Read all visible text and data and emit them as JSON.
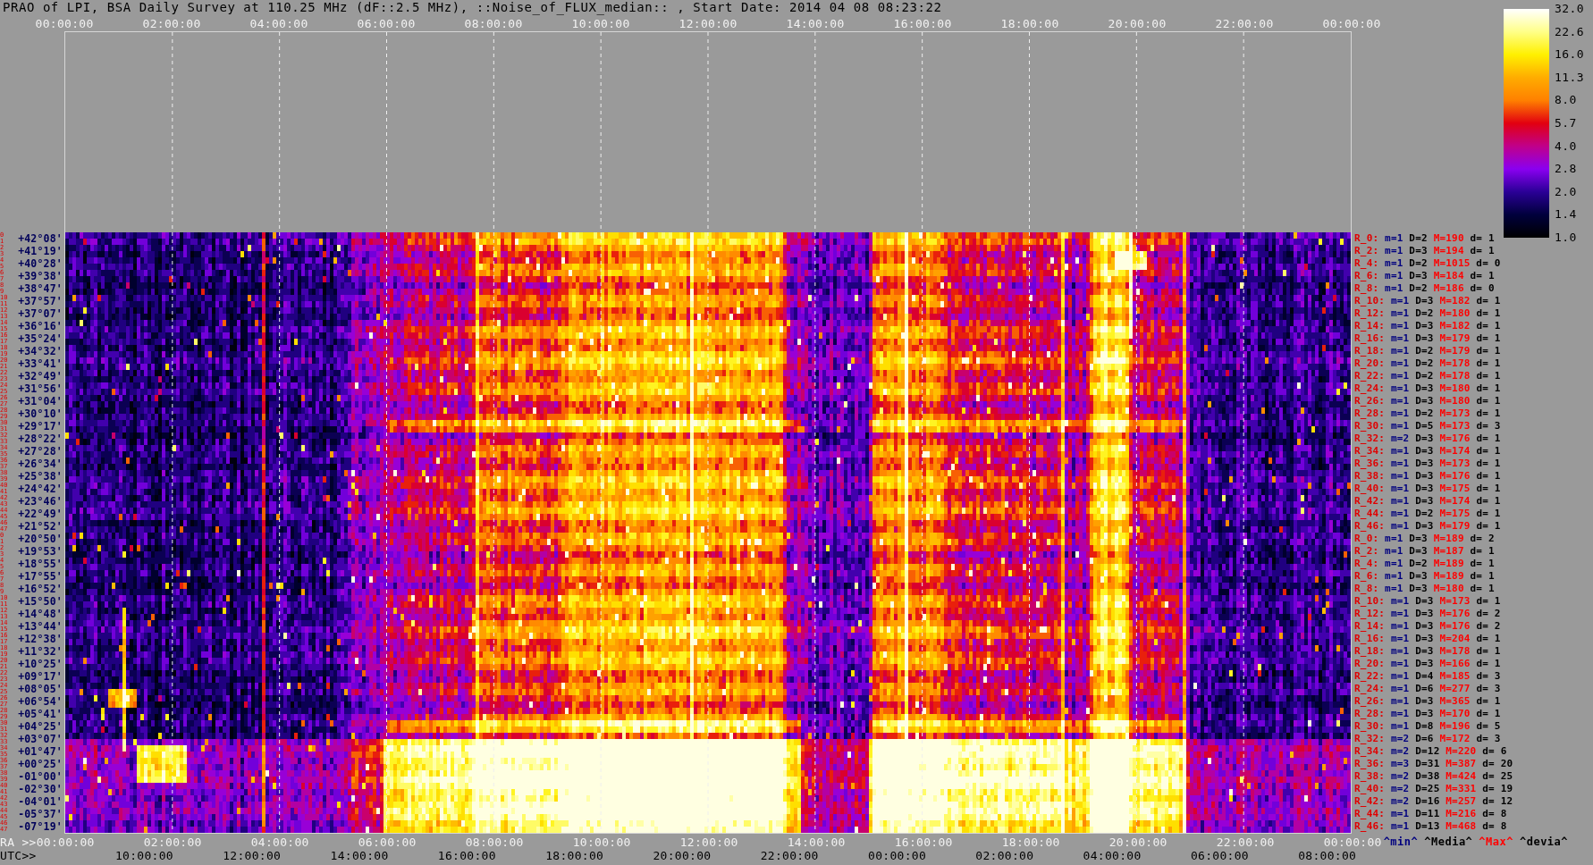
{
  "title": "PRAO of LPI, BSA Daily Survey at 110.25 MHz (dF::2.5 MHz), ::Noise_of_FLUX_median:: , Start Date: 2014 04 08 08:23:22",
  "top_axis": {
    "ticks": [
      "00:00:00",
      "02:00:00",
      "04:00:00",
      "06:00:00",
      "08:00:00",
      "10:00:00",
      "12:00:00",
      "14:00:00",
      "16:00:00",
      "18:00:00",
      "20:00:00",
      "22:00:00",
      "00:00:00"
    ]
  },
  "color_scale": {
    "labels": [
      "32.0",
      "22.6",
      "16.0",
      "11.3",
      "8.0",
      "5.7",
      "4.0",
      "2.8",
      "2.0",
      "1.4",
      "1.0"
    ]
  },
  "declination_axis": {
    "rows": [
      {
        "label": "+42°08'",
        "row_numbers": [
          "0",
          "1"
        ]
      },
      {
        "label": "+41°19'",
        "row_numbers": [
          "2",
          "3"
        ]
      },
      {
        "label": "+40°28'",
        "row_numbers": [
          "4",
          "5"
        ]
      },
      {
        "label": "+39°38'",
        "row_numbers": [
          "6",
          "7"
        ]
      },
      {
        "label": "+38°47'",
        "row_numbers": [
          "8",
          "9"
        ]
      },
      {
        "label": "+37°57'",
        "row_numbers": [
          "10",
          "11"
        ]
      },
      {
        "label": "+37°07'",
        "row_numbers": [
          "12",
          "13"
        ]
      },
      {
        "label": "+36°16'",
        "row_numbers": [
          "14",
          "15"
        ]
      },
      {
        "label": "+35°24'",
        "row_numbers": [
          "16",
          "17"
        ]
      },
      {
        "label": "+34°32'",
        "row_numbers": [
          "18",
          "19"
        ]
      },
      {
        "label": "+33°41'",
        "row_numbers": [
          "20",
          "21"
        ]
      },
      {
        "label": "+32°49'",
        "row_numbers": [
          "22",
          "23"
        ]
      },
      {
        "label": "+31°56'",
        "row_numbers": [
          "24",
          "25"
        ]
      },
      {
        "label": "+31°04'",
        "row_numbers": [
          "26",
          "27"
        ]
      },
      {
        "label": "+30°10'",
        "row_numbers": [
          "28",
          "29"
        ]
      },
      {
        "label": "+29°17'",
        "row_numbers": [
          "30",
          "31"
        ]
      },
      {
        "label": "+28°22'",
        "row_numbers": [
          "32",
          "33"
        ]
      },
      {
        "label": "+27°28'",
        "row_numbers": [
          "34",
          "35"
        ]
      },
      {
        "label": "+26°34'",
        "row_numbers": [
          "36",
          "37"
        ]
      },
      {
        "label": "+25°38'",
        "row_numbers": [
          "38",
          "39"
        ]
      },
      {
        "label": "+24°42'",
        "row_numbers": [
          "40",
          "41"
        ]
      },
      {
        "label": "+23°46'",
        "row_numbers": [
          "42",
          "43"
        ]
      },
      {
        "label": "+22°49'",
        "row_numbers": [
          "44",
          "45"
        ]
      },
      {
        "label": "+21°52'",
        "row_numbers": [
          "46",
          "47"
        ]
      },
      {
        "label": "+20°50'",
        "row_numbers": [
          "0",
          "1"
        ]
      },
      {
        "label": "+19°53'",
        "row_numbers": [
          "2",
          "3"
        ]
      },
      {
        "label": "+18°55'",
        "row_numbers": [
          "4",
          "5"
        ]
      },
      {
        "label": "+17°55'",
        "row_numbers": [
          "6",
          "7"
        ]
      },
      {
        "label": "+16°52'",
        "row_numbers": [
          "8",
          "9"
        ]
      },
      {
        "label": "+15°50'",
        "row_numbers": [
          "10",
          "11"
        ]
      },
      {
        "label": "+14°48'",
        "row_numbers": [
          "12",
          "13"
        ]
      },
      {
        "label": "+13°44'",
        "row_numbers": [
          "14",
          "15"
        ]
      },
      {
        "label": "+12°38'",
        "row_numbers": [
          "16",
          "17"
        ]
      },
      {
        "label": "+11°32'",
        "row_numbers": [
          "18",
          "19"
        ]
      },
      {
        "label": "+10°25'",
        "row_numbers": [
          "20",
          "21"
        ]
      },
      {
        "label": "+09°17'",
        "row_numbers": [
          "22",
          "23"
        ]
      },
      {
        "label": "+08°05'",
        "row_numbers": [
          "24",
          "25"
        ]
      },
      {
        "label": "+06°54'",
        "row_numbers": [
          "26",
          "27"
        ]
      },
      {
        "label": "+05°41'",
        "row_numbers": [
          "28",
          "29"
        ]
      },
      {
        "label": "+04°25'",
        "row_numbers": [
          "30",
          "31"
        ]
      },
      {
        "label": "+03°07'",
        "row_numbers": [
          "32",
          "33"
        ]
      },
      {
        "label": "+01°47'",
        "row_numbers": [
          "34",
          "35"
        ]
      },
      {
        "label": "+00°25'",
        "row_numbers": [
          "36",
          "37"
        ]
      },
      {
        "label": "-01°00'",
        "row_numbers": [
          "38",
          "39"
        ]
      },
      {
        "label": "-02°30'",
        "row_numbers": [
          "40",
          "41"
        ]
      },
      {
        "label": "-04°01'",
        "row_numbers": [
          "42",
          "43"
        ]
      },
      {
        "label": "-05°37'",
        "row_numbers": [
          "44",
          "45"
        ]
      },
      {
        "label": "-07°19'",
        "row_numbers": [
          "46",
          "47"
        ]
      }
    ]
  },
  "row_statistics": [
    {
      "row": "R_0:",
      "min": "m=1",
      "median": "D=2",
      "max": "M=190",
      "deviation": "d= 1"
    },
    {
      "row": "R_2:",
      "min": "m=1",
      "median": "D=3",
      "max": "M=194",
      "deviation": "d= 1"
    },
    {
      "row": "R_4:",
      "min": "m=1",
      "median": "D=2",
      "max": "M=1015",
      "deviation": "d= 0"
    },
    {
      "row": "R_6:",
      "min": "m=1",
      "median": "D=3",
      "max": "M=184",
      "deviation": "d= 1"
    },
    {
      "row": "R_8:",
      "min": "m=1",
      "median": "D=2",
      "max": "M=186",
      "deviation": "d= 0"
    },
    {
      "row": "R_10:",
      "min": "m=1",
      "median": "D=3",
      "max": "M=182",
      "deviation": "d= 1"
    },
    {
      "row": "R_12:",
      "min": "m=1",
      "median": "D=2",
      "max": "M=180",
      "deviation": "d= 1"
    },
    {
      "row": "R_14:",
      "min": "m=1",
      "median": "D=3",
      "max": "M=182",
      "deviation": "d= 1"
    },
    {
      "row": "R_16:",
      "min": "m=1",
      "median": "D=3",
      "max": "M=179",
      "deviation": "d= 1"
    },
    {
      "row": "R_18:",
      "min": "m=1",
      "median": "D=2",
      "max": "M=179",
      "deviation": "d= 1"
    },
    {
      "row": "R_20:",
      "min": "m=1",
      "median": "D=2",
      "max": "M=178",
      "deviation": "d= 1"
    },
    {
      "row": "R_22:",
      "min": "m=1",
      "median": "D=2",
      "max": "M=178",
      "deviation": "d= 1"
    },
    {
      "row": "R_24:",
      "min": "m=1",
      "median": "D=3",
      "max": "M=180",
      "deviation": "d= 1"
    },
    {
      "row": "R_26:",
      "min": "m=1",
      "median": "D=3",
      "max": "M=180",
      "deviation": "d= 1"
    },
    {
      "row": "R_28:",
      "min": "m=1",
      "median": "D=2",
      "max": "M=173",
      "deviation": "d= 1"
    },
    {
      "row": "R_30:",
      "min": "m=1",
      "median": "D=5",
      "max": "M=173",
      "deviation": "d= 3"
    },
    {
      "row": "R_32:",
      "min": "m=2",
      "median": "D=3",
      "max": "M=176",
      "deviation": "d= 1"
    },
    {
      "row": "R_34:",
      "min": "m=1",
      "median": "D=3",
      "max": "M=174",
      "deviation": "d= 1"
    },
    {
      "row": "R_36:",
      "min": "m=1",
      "median": "D=3",
      "max": "M=173",
      "deviation": "d= 1"
    },
    {
      "row": "R_38:",
      "min": "m=1",
      "median": "D=3",
      "max": "M=176",
      "deviation": "d= 1"
    },
    {
      "row": "R_40:",
      "min": "m=1",
      "median": "D=3",
      "max": "M=175",
      "deviation": "d= 1"
    },
    {
      "row": "R_42:",
      "min": "m=1",
      "median": "D=3",
      "max": "M=174",
      "deviation": "d= 1"
    },
    {
      "row": "R_44:",
      "min": "m=1",
      "median": "D=2",
      "max": "M=175",
      "deviation": "d= 1"
    },
    {
      "row": "R_46:",
      "min": "m=1",
      "median": "D=3",
      "max": "M=179",
      "deviation": "d= 1"
    },
    {
      "row": "R_0:",
      "min": "m=1",
      "median": "D=3",
      "max": "M=189",
      "deviation": "d= 2"
    },
    {
      "row": "R_2:",
      "min": "m=1",
      "median": "D=3",
      "max": "M=187",
      "deviation": "d= 1"
    },
    {
      "row": "R_4:",
      "min": "m=1",
      "median": "D=2",
      "max": "M=189",
      "deviation": "d= 1"
    },
    {
      "row": "R_6:",
      "min": "m=1",
      "median": "D=3",
      "max": "M=189",
      "deviation": "d= 1"
    },
    {
      "row": "R_8:",
      "min": "m=1",
      "median": "D=3",
      "max": "M=180",
      "deviation": "d= 1"
    },
    {
      "row": "R_10:",
      "min": "m=1",
      "median": "D=3",
      "max": "M=173",
      "deviation": "d= 1"
    },
    {
      "row": "R_12:",
      "min": "m=1",
      "median": "D=3",
      "max": "M=176",
      "deviation": "d= 2"
    },
    {
      "row": "R_14:",
      "min": "m=1",
      "median": "D=3",
      "max": "M=176",
      "deviation": "d= 2"
    },
    {
      "row": "R_16:",
      "min": "m=1",
      "median": "D=3",
      "max": "M=204",
      "deviation": "d= 1"
    },
    {
      "row": "R_18:",
      "min": "m=1",
      "median": "D=3",
      "max": "M=178",
      "deviation": "d= 1"
    },
    {
      "row": "R_20:",
      "min": "m=1",
      "median": "D=3",
      "max": "M=166",
      "deviation": "d= 1"
    },
    {
      "row": "R_22:",
      "min": "m=1",
      "median": "D=4",
      "max": "M=185",
      "deviation": "d= 3"
    },
    {
      "row": "R_24:",
      "min": "m=1",
      "median": "D=6",
      "max": "M=277",
      "deviation": "d= 3"
    },
    {
      "row": "R_26:",
      "min": "m=1",
      "median": "D=3",
      "max": "M=365",
      "deviation": "d= 1"
    },
    {
      "row": "R_28:",
      "min": "m=1",
      "median": "D=3",
      "max": "M=170",
      "deviation": "d= 1"
    },
    {
      "row": "R_30:",
      "min": "m=1",
      "median": "D=8",
      "max": "M=196",
      "deviation": "d= 5"
    },
    {
      "row": "R_32:",
      "min": "m=2",
      "median": "D=6",
      "max": "M=172",
      "deviation": "d= 3"
    },
    {
      "row": "R_34:",
      "min": "m=2",
      "median": "D=12",
      "max": "M=220",
      "deviation": "d= 6"
    },
    {
      "row": "R_36:",
      "min": "m=3",
      "median": "D=31",
      "max": "M=387",
      "deviation": "d= 20"
    },
    {
      "row": "R_38:",
      "min": "m=2",
      "median": "D=38",
      "max": "M=424",
      "deviation": "d= 25"
    },
    {
      "row": "R_40:",
      "min": "m=2",
      "median": "D=25",
      "max": "M=331",
      "deviation": "d= 19"
    },
    {
      "row": "R_42:",
      "min": "m=2",
      "median": "D=16",
      "max": "M=257",
      "deviation": "d= 12"
    },
    {
      "row": "R_44:",
      "min": "m=1",
      "median": "D=11",
      "max": "M=216",
      "deviation": "d= 8"
    },
    {
      "row": "R_46:",
      "min": "m=1",
      "median": "D=13",
      "max": "M=468",
      "deviation": "d= 8"
    }
  ],
  "ra_axis": {
    "label": "RA >>",
    "ticks": [
      "00:00:00",
      "02:00:00",
      "04:00:00",
      "06:00:00",
      "08:00:00",
      "10:00:00",
      "12:00:00",
      "14:00:00",
      "16:00:00",
      "18:00:00",
      "20:00:00",
      "22:00:00",
      "00:00:00"
    ]
  },
  "stats_legend": [
    {
      "label": "^min^",
      "color": "#00007f"
    },
    {
      "label": "^Media^",
      "color": "#000000"
    },
    {
      "label": "^Max^",
      "color": "#ff0000"
    },
    {
      "label": "^devia^",
      "color": "#000000"
    }
  ],
  "utc_axis": {
    "label": "UTC>>",
    "ticks": [
      "10:00:00",
      "12:00:00",
      "14:00:00",
      "16:00:00",
      "18:00:00",
      "20:00:00",
      "22:00:00",
      "00:00:00",
      "02:00:00",
      "04:00:00",
      "06:00:00",
      "08:00:00"
    ]
  }
}
